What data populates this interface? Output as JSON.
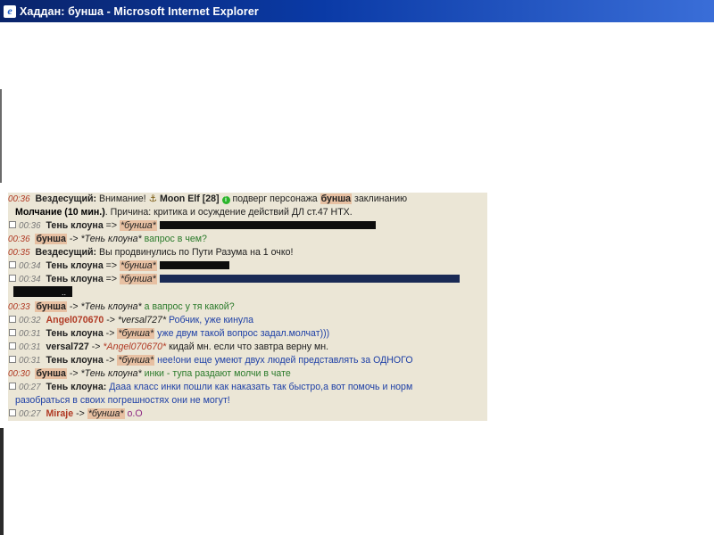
{
  "window": {
    "title": "Хаддан: бунша - Microsoft Internet Explorer"
  },
  "chat": {
    "lines": [
      {
        "time": "00:36",
        "nick": "Вездесущий:",
        "text_a": "Внимание!",
        "target": "Moon Elf",
        "level": "[28]",
        "text_b": "подверг персонажа",
        "victim": "бунша",
        "text_c": "заклинанию",
        "cont_bold": "Молчание (10 мин.)",
        "cont_text": ". Причина: критика и осуждение действий ДЛ ст.47 НТХ."
      },
      {
        "time": "00:36",
        "nick": "Тень клоуна",
        "arrow": "=>",
        "to": "*бунша*"
      },
      {
        "time": "00:36",
        "nick": "бунша",
        "arrow": "->",
        "to": "*Тень клоуна*",
        "text": "вапрос в чем?"
      },
      {
        "time": "00:35",
        "nick": "Вездесущий:",
        "text": "Вы продвинулись по Пути Разума на 1 очко!"
      },
      {
        "time": "00:34",
        "nick": "Тень клоуна",
        "arrow": "=>",
        "to": "*бунша*"
      },
      {
        "time": "00:34",
        "nick": "Тень клоуна",
        "arrow": "=>",
        "to": "*бунша*",
        "cont": ".."
      },
      {
        "time": "00:33",
        "nick": "бунша",
        "arrow": "->",
        "to": "*Тень клоуна*",
        "text": "а вапрос у тя какой?"
      },
      {
        "time": "00:32",
        "nick": "Angel070670",
        "arrow": "->",
        "to": "*versal727*",
        "text": "Робчик, уже кинула"
      },
      {
        "time": "00:31",
        "nick": "Тень клоуна",
        "arrow": "->",
        "to": "*бунша*",
        "text": "уже двум такой вопрос задал.молчат)))"
      },
      {
        "time": "00:31",
        "nick": "versal727",
        "arrow": "->",
        "to": "*Angel070670*",
        "text": "кидай мн. если что завтра верну мн."
      },
      {
        "time": "00:31",
        "nick": "Тень клоуна",
        "arrow": "->",
        "to": "*бунша*",
        "text": "нее!они еще умеют двух людей представлять за ОДНОГО"
      },
      {
        "time": "00:30",
        "nick": "бунша",
        "arrow": "->",
        "to": "*Тень клоуна*",
        "text": "инки - тупа раздают молчи в чате"
      },
      {
        "time": "00:27",
        "nick": "Тень клоуна:",
        "text": "Дааа класс инки пошли как наказать так быстро,а вот помочь и норм",
        "cont": "разобраться в своих погрешностях они не могут!"
      },
      {
        "time": "00:27",
        "nick": "Miraje",
        "arrow": "->",
        "to": "*бунша*",
        "text": "о.О"
      }
    ]
  },
  "icons": {
    "window": "ie-icon",
    "anchor": "anchor-icon",
    "status": "status-dot-icon",
    "checkbox": "checkbox-icon"
  },
  "colors": {
    "titlebar": "#0a246a",
    "chat_bg": "#ebe6d6",
    "timestamp": "#b03a24",
    "highlight": "#e7c0a2",
    "link_blue": "#1d3fa6"
  }
}
